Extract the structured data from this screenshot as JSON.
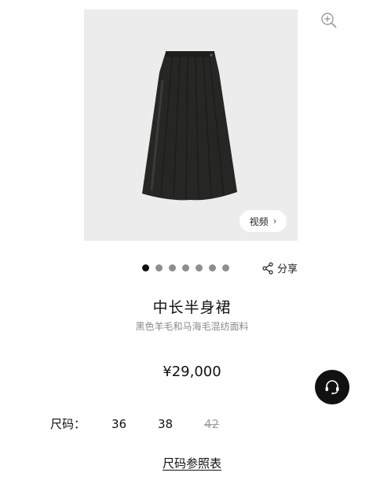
{
  "product": {
    "image_alt_icon": "skirt-image",
    "video_label": "视频",
    "video_chevron": "›",
    "title": "中长半身裙",
    "subtitle": "黑色羊毛和马海毛混纺面料",
    "price": "¥29,000"
  },
  "carousel": {
    "dot_count": 7,
    "active_index": 0
  },
  "share": {
    "label": "分享",
    "icon": "share-icon"
  },
  "sizes": {
    "label": "尺码：",
    "options": [
      {
        "value": "36",
        "available": true
      },
      {
        "value": "38",
        "available": true
      },
      {
        "value": "42",
        "available": false
      }
    ],
    "guide_label": "尺码参照表"
  },
  "icons": {
    "zoom": "zoom-in-icon",
    "support": "headset-icon"
  },
  "colors": {
    "image_bg": "#ececec",
    "dot_active": "#111111",
    "dot_inactive": "#8e8e8e",
    "support_bg": "#111111"
  }
}
